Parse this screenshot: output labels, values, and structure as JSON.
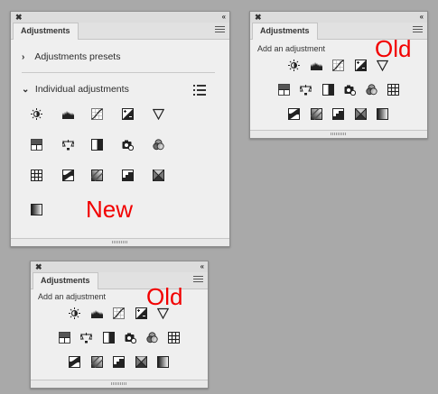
{
  "panel_new": {
    "close_glyph": "✖",
    "collapse_glyph": "‹‹",
    "tab_label": "Adjustments",
    "presets_label": "Adjustments presets",
    "individual_label": "Individual adjustments",
    "annotation": "New"
  },
  "panel_old_top": {
    "close_glyph": "✖",
    "collapse_glyph": "‹‹",
    "tab_label": "Adjustments",
    "add_label": "Add an adjustment",
    "annotation": "Old"
  },
  "panel_old_bottom": {
    "close_glyph": "✖",
    "collapse_glyph": "‹‹",
    "tab_label": "Adjustments",
    "add_label": "Add an adjustment",
    "annotation": "Old"
  },
  "icons": {
    "row1": [
      "brightness-contrast-icon",
      "levels-icon",
      "curves-icon",
      "exposure-icon",
      "vibrance-icon"
    ],
    "row2": [
      "hue-saturation-icon",
      "color-balance-icon",
      "black-white-icon",
      "photo-filter-icon",
      "channel-mixer-icon",
      "color-lookup-icon"
    ],
    "row3": [
      "invert-icon",
      "posterize-icon",
      "threshold-icon",
      "selective-color-icon",
      "gradient-map-icon"
    ]
  },
  "colors": {
    "annotation": "#f20000",
    "background": "#a9a9a9",
    "panel": "#efefef"
  }
}
